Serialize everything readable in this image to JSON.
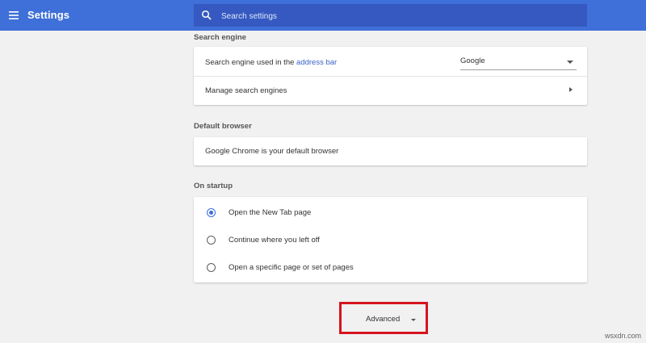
{
  "header": {
    "title": "Settings",
    "menu_icon": "hamburger-menu-icon",
    "search_icon": "search-icon",
    "search_placeholder": "Search settings",
    "color": "#3f6fd8"
  },
  "search_engine": {
    "section_title": "Search engine",
    "row1_prefix": "Search engine used in the ",
    "row1_link": "address bar",
    "selected_engine": "Google",
    "row2_label": "Manage search engines"
  },
  "default_browser": {
    "section_title": "Default browser",
    "status": "Google Chrome is your default browser"
  },
  "on_startup": {
    "section_title": "On startup",
    "options": [
      {
        "label": "Open the New Tab page",
        "selected": true
      },
      {
        "label": "Continue where you left off",
        "selected": false
      },
      {
        "label": "Open a specific page or set of pages",
        "selected": false
      }
    ]
  },
  "advanced": {
    "label": "Advanced",
    "highlight_color": "#d6141e"
  },
  "watermark": "wsxdn.com"
}
